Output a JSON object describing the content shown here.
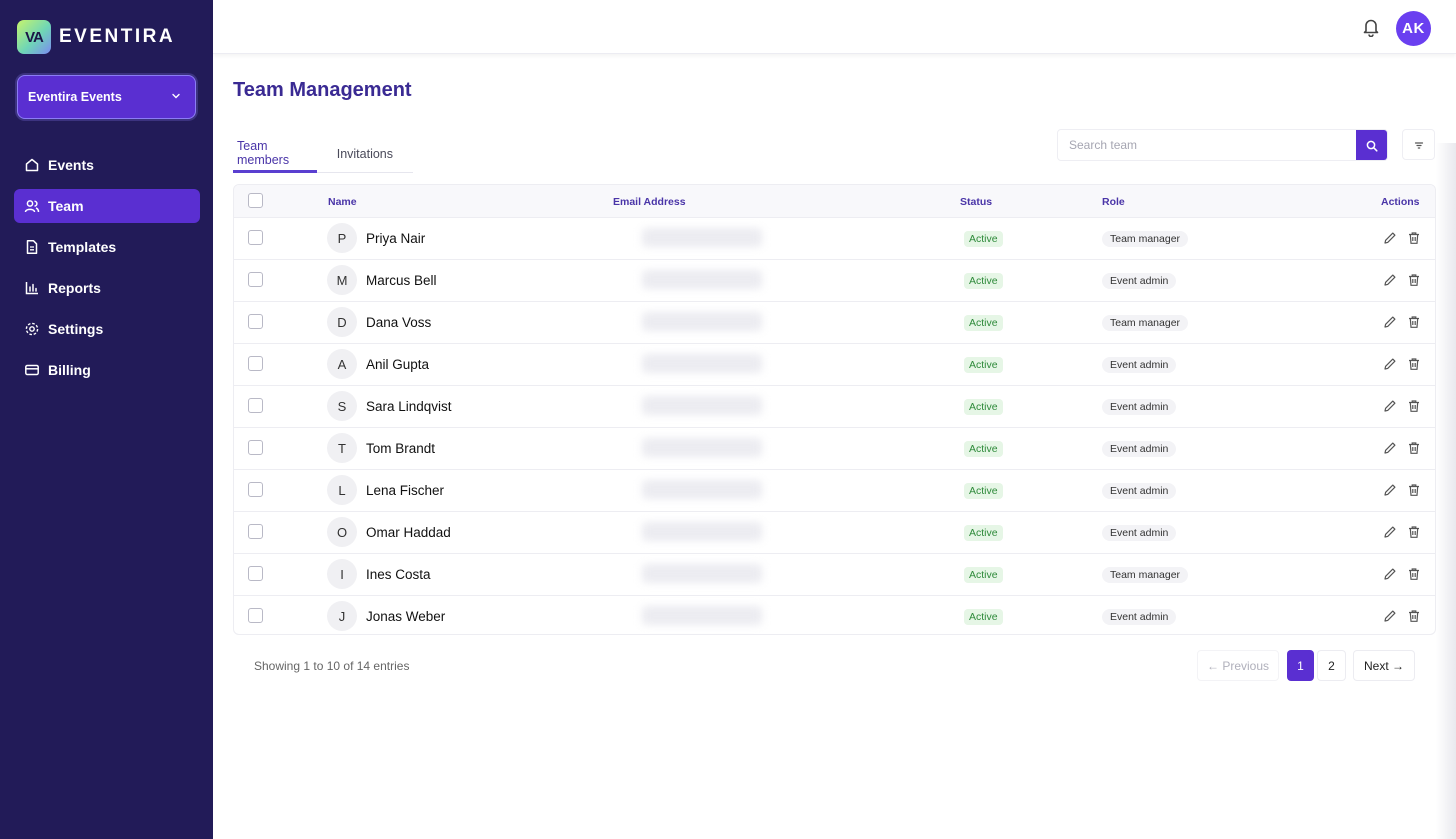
{
  "brand": {
    "logo_text": "VA",
    "name": "EVENTIRA"
  },
  "workspace": {
    "label": "Eventira Events"
  },
  "nav": [
    {
      "label": "Events",
      "icon": "home-icon"
    },
    {
      "label": "Team",
      "icon": "users-icon",
      "active": true
    },
    {
      "label": "Templates",
      "icon": "file-icon"
    },
    {
      "label": "Reports",
      "icon": "bar-chart-icon"
    },
    {
      "label": "Settings",
      "icon": "gear-icon"
    },
    {
      "label": "Billing",
      "icon": "card-icon"
    }
  ],
  "user": {
    "initials": "AK"
  },
  "page": {
    "title": "Team Management"
  },
  "tabs": [
    {
      "label": "Team members",
      "active": true
    },
    {
      "label": "Invitations"
    }
  ],
  "search": {
    "placeholder": "Search team"
  },
  "table": {
    "columns": {
      "name": "Name",
      "email": "Email Address",
      "status": "Status",
      "role": "Role",
      "actions": "Actions"
    },
    "rows": [
      {
        "initial": "P",
        "name": "Priya Nair",
        "status": "Active",
        "role": "Team manager"
      },
      {
        "initial": "M",
        "name": "Marcus Bell",
        "status": "Active",
        "role": "Event admin"
      },
      {
        "initial": "D",
        "name": "Dana Voss",
        "status": "Active",
        "role": "Team manager"
      },
      {
        "initial": "A",
        "name": "Anil Gupta",
        "status": "Active",
        "role": "Event admin"
      },
      {
        "initial": "S",
        "name": "Sara Lindqvist",
        "status": "Active",
        "role": "Event admin"
      },
      {
        "initial": "T",
        "name": "Tom Brandt",
        "status": "Active",
        "role": "Event admin"
      },
      {
        "initial": "L",
        "name": "Lena Fischer",
        "status": "Active",
        "role": "Event admin"
      },
      {
        "initial": "O",
        "name": "Omar Haddad",
        "status": "Active",
        "role": "Event admin"
      },
      {
        "initial": "I",
        "name": "Ines Costa",
        "status": "Active",
        "role": "Team manager"
      },
      {
        "initial": "J",
        "name": "Jonas Weber",
        "status": "Active",
        "role": "Event admin"
      }
    ]
  },
  "pagination": {
    "summary": "Showing 1 to 10 of 14 entries",
    "previous": "← Previous",
    "pages": [
      "1",
      "2"
    ],
    "current": "1",
    "next": "Next →"
  },
  "colors": {
    "sidebar": "#221b58",
    "accent": "#5a2fd1",
    "title": "#3a2a93",
    "status_green": "#2e8a3a"
  }
}
